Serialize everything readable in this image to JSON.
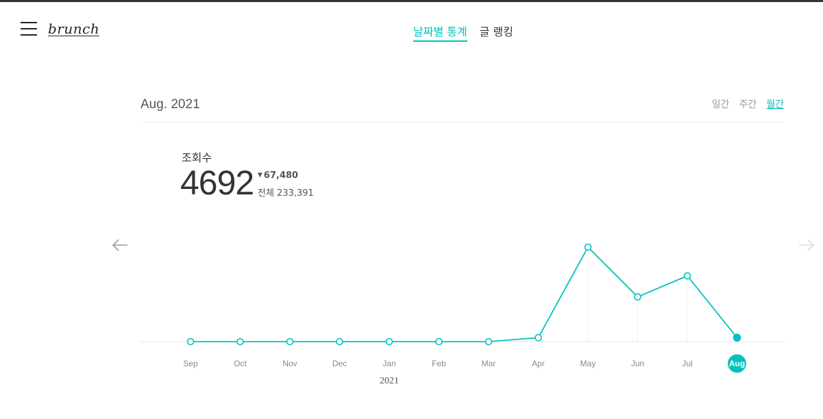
{
  "header": {
    "logo": "brunch",
    "tabs": [
      {
        "label": "날짜별 통계",
        "active": true
      },
      {
        "label": "글 랭킹",
        "active": false
      }
    ]
  },
  "stats": {
    "period_label": "Aug. 2021",
    "ranges": [
      {
        "label": "일간",
        "active": false
      },
      {
        "label": "주간",
        "active": false
      },
      {
        "label": "월간",
        "active": true
      }
    ],
    "metric_label": "조회수",
    "metric_value": "4692",
    "delta": "67,480",
    "total": "전체 233,391"
  },
  "nav": {
    "prev_icon": "arrow-left-icon",
    "next_icon": "arrow-right-icon"
  },
  "colors": {
    "accent": "#00c3bd",
    "baseline": "#e6e6e6"
  },
  "chart_data": {
    "type": "line",
    "categories": [
      "Sep",
      "Oct",
      "Nov",
      "Dec",
      "Jan",
      "Feb",
      "Mar",
      "Apr",
      "May",
      "Jun",
      "Jul",
      "Aug"
    ],
    "values": [
      0,
      0,
      0,
      0,
      0,
      0,
      0,
      4692,
      112000,
      53000,
      78000,
      4692
    ],
    "selected": "Aug",
    "year_label": "2021",
    "ylim": [
      0,
      112000
    ]
  }
}
